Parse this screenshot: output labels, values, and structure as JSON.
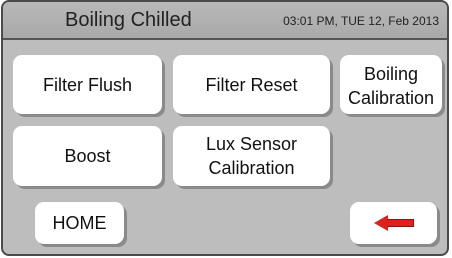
{
  "header": {
    "title": "Boiling Chilled",
    "datetime": "03:01 PM, TUE 12, Feb 2013"
  },
  "buttons": {
    "filter_flush": "Filter Flush",
    "filter_reset": "Filter Reset",
    "boiling_calibration_line1": "Boiling",
    "boiling_calibration_line2": "Calibration",
    "boost": "Boost",
    "lux_sensor_calibration_line1": "Lux Sensor",
    "lux_sensor_calibration_line2": "Calibration",
    "home": "HOME"
  },
  "icons": {
    "back": "left-arrow-icon"
  },
  "colors": {
    "screen_background": "#bdbdbd",
    "button_face": "#ffffff",
    "arrow": "#e0201c"
  }
}
